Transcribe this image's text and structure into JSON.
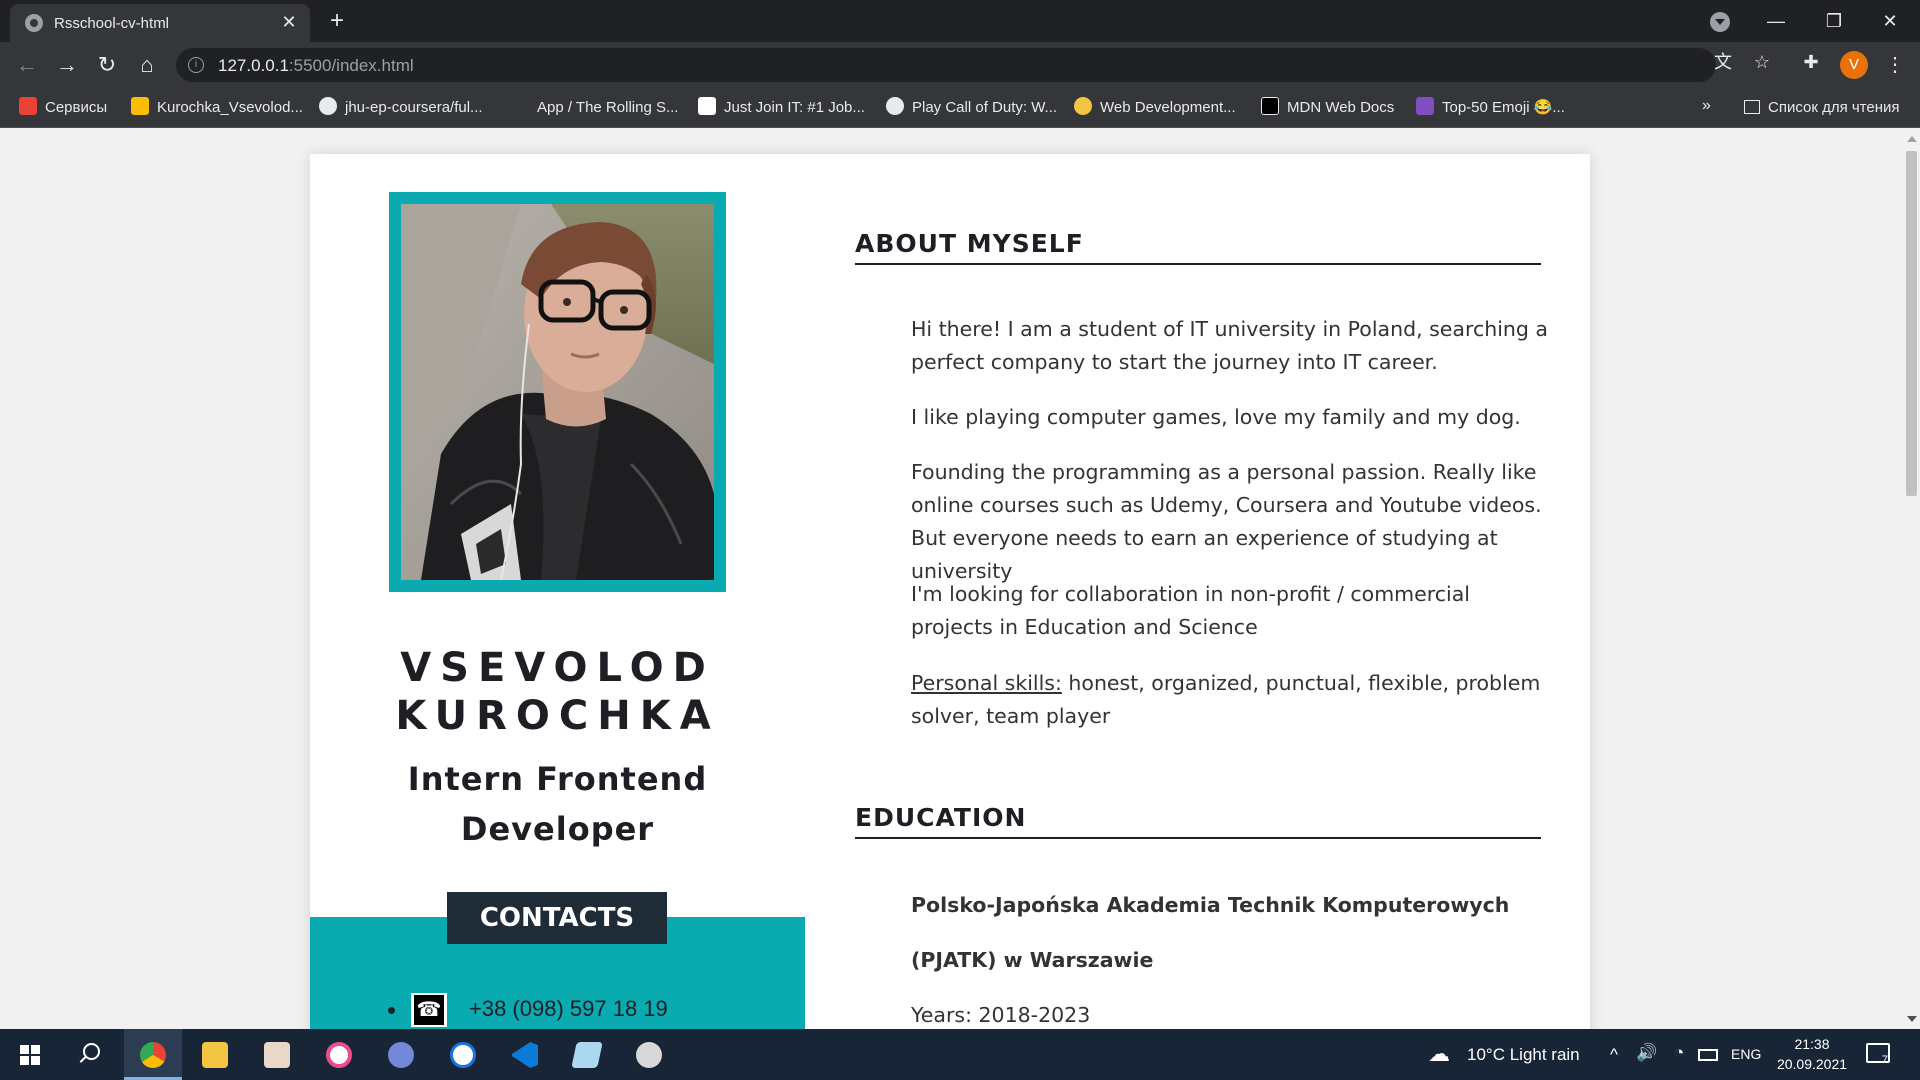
{
  "browser": {
    "tab_title": "Rsschool-cv-html",
    "tab_close": "✕",
    "new_tab": "+",
    "url_host": "127.0.0.1",
    "url_path": ":5500/index.html",
    "profile_initial": "V",
    "window_controls": {
      "minimize": "—",
      "restore": "❐",
      "close": "✕"
    },
    "nav": {
      "back": "←",
      "forward": "→",
      "reload": "↻",
      "home": "⌂"
    },
    "bookmarks": [
      {
        "label": "Сервисы",
        "icon": "apps-grid-icon",
        "color": "#ea4335"
      },
      {
        "label": "Kurochka_Vsevolod...",
        "icon": "google-drive-icon",
        "color": "#fbbc04"
      },
      {
        "label": "jhu-ep-coursera/ful...",
        "icon": "github-icon",
        "color": "#e8eaed"
      },
      {
        "label": "App / The Rolling S...",
        "icon": "rolling-scopes-icon",
        "color": "#35363a"
      },
      {
        "label": "Just Join IT: #1 Job...",
        "icon": "justjoinit-icon",
        "color": "#ffffff"
      },
      {
        "label": "Play Call of Duty: W...",
        "icon": "globe-icon",
        "color": "#e8eaed"
      },
      {
        "label": "Web Development...",
        "icon": "udemy-icon",
        "color": "#f4c542"
      },
      {
        "label": "MDN Web Docs",
        "icon": "mdn-icon",
        "color": "#000000"
      },
      {
        "label": "Top-50 Emoji 😂...",
        "icon": "ut-icon",
        "color": "#7d4fbf"
      }
    ],
    "bookmarks_more": "»",
    "reading_list": "Список для чтения"
  },
  "cv": {
    "name_line1": "VSEVOLOD",
    "name_line2": "KUROCHKA",
    "title_line1": "Intern Frontend",
    "title_line2": "Developer",
    "contacts_heading": "CONTACTS",
    "phone": "+38 (098) 597 18 19",
    "about_heading": "ABOUT MYSELF",
    "about_paragraphs": [
      "Hi there! I am a student of IT university in Poland, searching a perfect company to start the journey into IT career.",
      "I like playing computer games, love my family and my dog.",
      "Founding the programming as a personal passion. Really like online courses such as Udemy, Coursera and Youtube videos. But everyone needs to earn an experience of studying at university",
      "I'm looking for collaboration in non-profit / commercial projects in Education and Science"
    ],
    "skills_label": "Personal skills:",
    "skills_text": " honest, organized, punctual, flexible, problem solver, team player",
    "education_heading": "EDUCATION",
    "edu_school_line1": "Polsko-Japońska Akademia Technik Komputerowych",
    "edu_school_line2": "(PJATK) w Warszawie",
    "edu_years": "Years: 2018-2023",
    "accent_color": "#0aaab1",
    "dark_color": "#1f2b36"
  },
  "taskbar": {
    "weather": "10°C  Light rain",
    "language": "ENG",
    "time": "21:38",
    "date": "20.09.2021",
    "notifications": "7",
    "tray_chevron": "^",
    "apps": [
      "start-icon",
      "search-icon",
      "chrome-icon",
      "file-explorer-icon",
      "mediaget-icon",
      "itunes-icon",
      "discord-icon",
      "paint-3d-icon",
      "vscode-icon",
      "notepad-icon",
      "photos-icon"
    ]
  }
}
